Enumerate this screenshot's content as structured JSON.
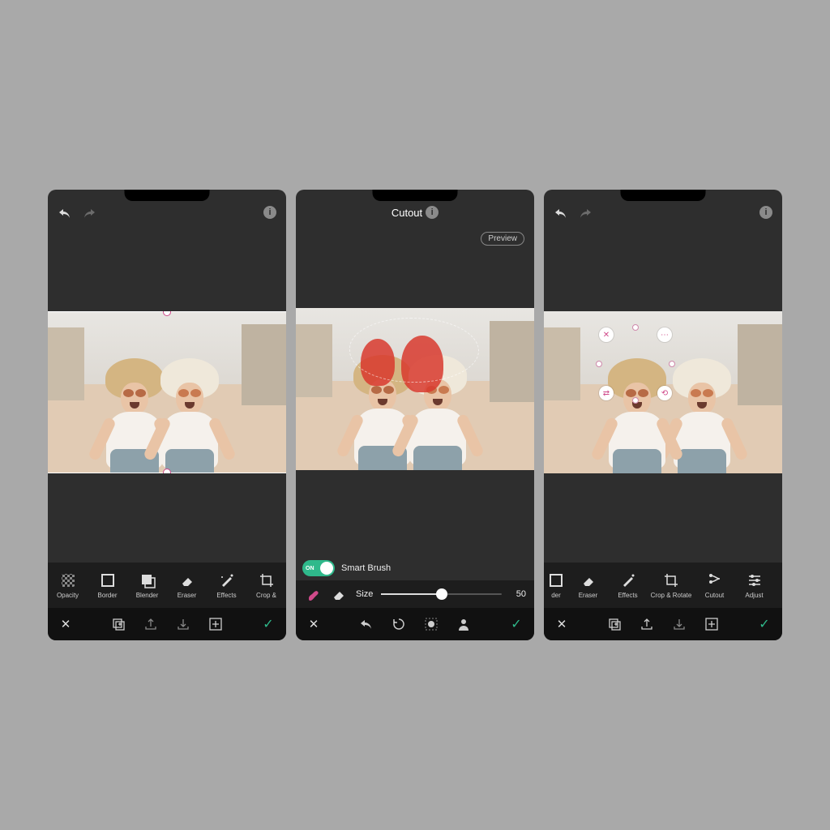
{
  "colors": {
    "accent": "#2fb98b",
    "pink": "#d04a8a",
    "red_mask": "#d83a2e"
  },
  "screen1": {
    "topbar": {
      "undo": "↶",
      "redo": "↷",
      "info": "i"
    },
    "tools": [
      {
        "id": "opacity",
        "label": "Opacity"
      },
      {
        "id": "border",
        "label": "Border"
      },
      {
        "id": "blender",
        "label": "Blender"
      },
      {
        "id": "eraser",
        "label": "Eraser"
      },
      {
        "id": "effects",
        "label": "Effects"
      },
      {
        "id": "crop-rotate",
        "label": "Crop & "
      }
    ],
    "actions": {
      "close": "✕",
      "duplicate": "⧉",
      "export": "⤴",
      "import": "⤵",
      "add": "＋",
      "confirm": "✓"
    }
  },
  "screen2": {
    "title": "Cutout",
    "info": "i",
    "preview": "Preview",
    "smart_brush": {
      "toggle": "ON",
      "label": "Smart Brush"
    },
    "selection_icons": {
      "brush": "brush",
      "eraser": "eraser"
    },
    "size": {
      "label": "Size",
      "value": "50",
      "percent": 50
    },
    "actions": {
      "close": "✕",
      "undo": "↶",
      "reset": "↻",
      "mask": "●",
      "person": "👤",
      "confirm": "✓"
    }
  },
  "screen3": {
    "topbar": {
      "undo": "↶",
      "redo": "↷",
      "info": "i"
    },
    "tools": [
      {
        "id": "border-partial",
        "label": "der"
      },
      {
        "id": "eraser",
        "label": "Eraser"
      },
      {
        "id": "effects",
        "label": "Effects"
      },
      {
        "id": "crop-rotate",
        "label": "Crop & Rotate"
      },
      {
        "id": "cutout",
        "label": "Cutout"
      },
      {
        "id": "adjust",
        "label": "Adjust"
      }
    ],
    "actions": {
      "close": "✕",
      "duplicate": "⧉",
      "export": "⤴",
      "import": "⤵",
      "add": "＋",
      "confirm": "✓"
    }
  }
}
